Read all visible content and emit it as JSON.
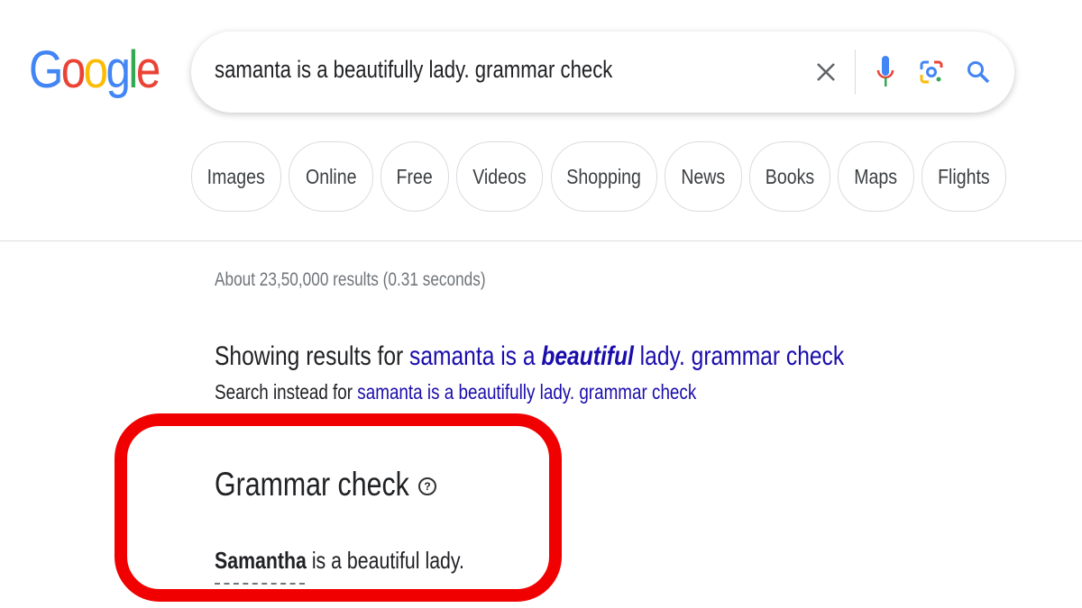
{
  "logo": {
    "text": "Google",
    "letters": [
      {
        "c": "G",
        "color": "#4285f4"
      },
      {
        "c": "o",
        "color": "#ea4335"
      },
      {
        "c": "o",
        "color": "#fbbc05"
      },
      {
        "c": "g",
        "color": "#4285f4"
      },
      {
        "c": "l",
        "color": "#34a853"
      },
      {
        "c": "e",
        "color": "#ea4335"
      }
    ]
  },
  "search": {
    "query": "samanta is a beautifully lady. grammar check",
    "icons": [
      "close-icon",
      "microphone-icon",
      "lens-icon",
      "search-icon"
    ]
  },
  "chips": [
    "Images",
    "Online",
    "Free",
    "Videos",
    "Shopping",
    "News",
    "Books",
    "Maps",
    "Flights"
  ],
  "results": {
    "stats": "About 23,50,000 results (0.31 seconds)",
    "showing_prefix": "Showing results for ",
    "showing_link_a": "samanta is a ",
    "showing_link_bold": "beautiful",
    "showing_link_b": " lady. grammar check",
    "instead_prefix": "Search instead for ",
    "instead_link": "samanta is a beautifully lady. grammar check"
  },
  "grammar": {
    "title": "Grammar check",
    "help": "?",
    "corrected_word": "Samantha",
    "rest": " is a beautiful lady."
  },
  "colors": {
    "link": "#1a0dab",
    "highlight_box": "#f00000"
  }
}
